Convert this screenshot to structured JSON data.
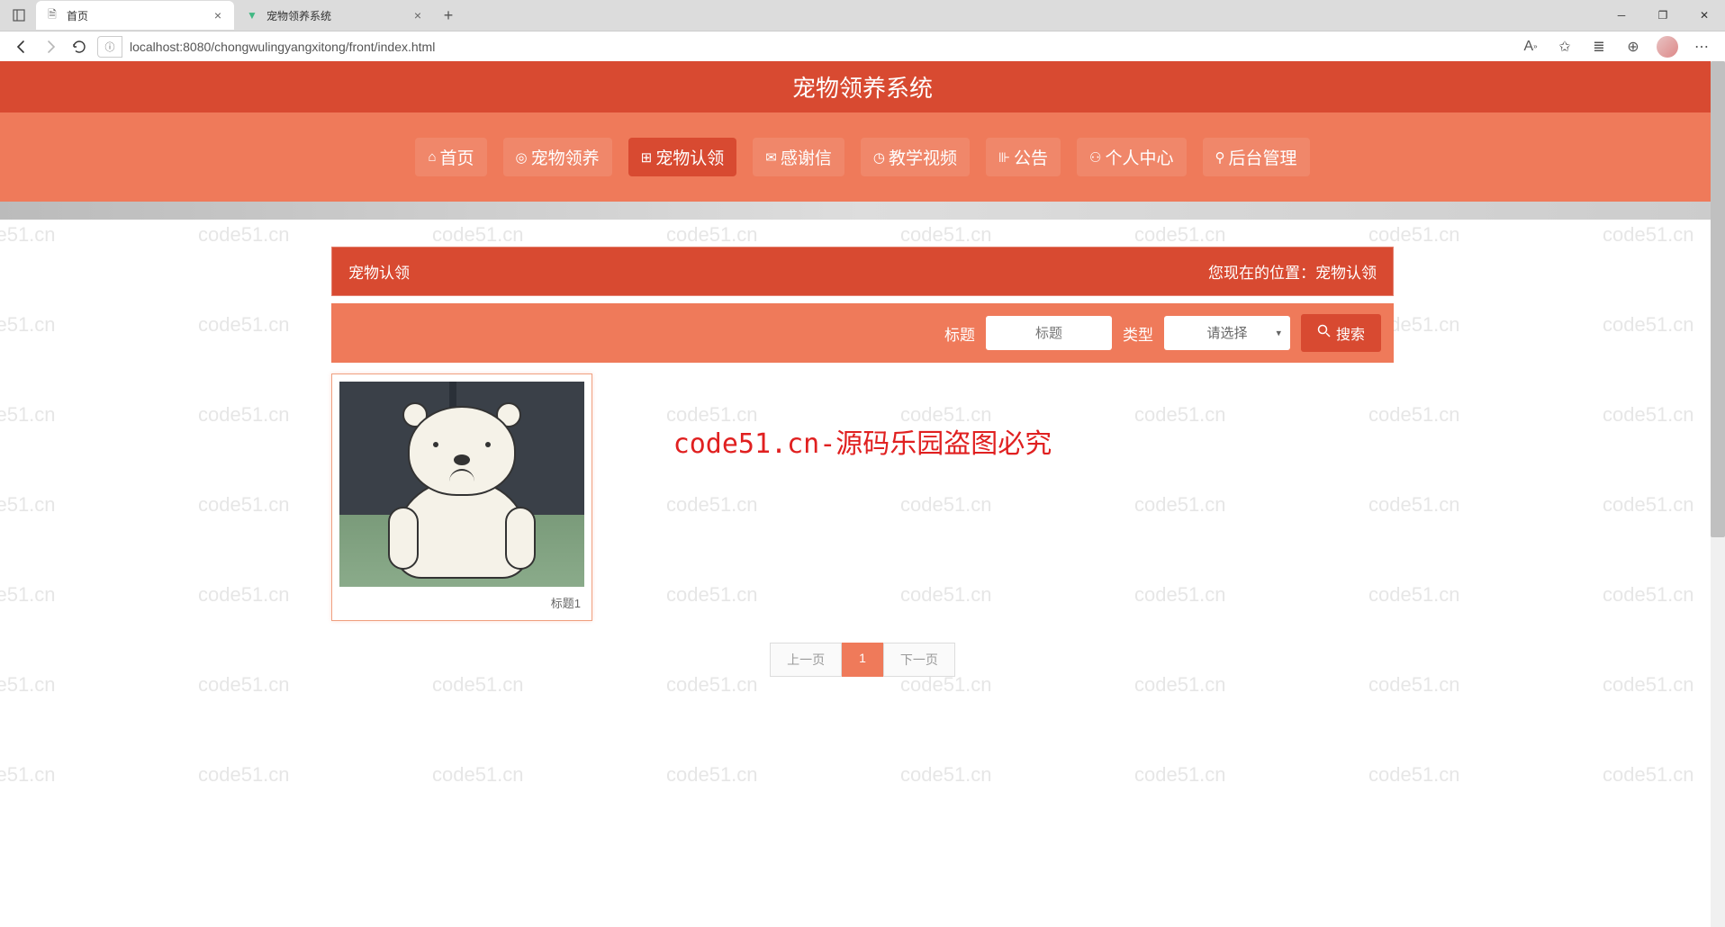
{
  "browser": {
    "tabs": [
      {
        "title": "首页",
        "active": true
      },
      {
        "title": "宠物领养系统",
        "active": false
      }
    ],
    "url": "localhost:8080/chongwulingyangxitong/front/index.html"
  },
  "header": {
    "title": "宠物领养系统"
  },
  "nav": {
    "items": [
      {
        "icon": "⌂",
        "label": "首页",
        "active": false
      },
      {
        "icon": "◎",
        "label": "宠物领养",
        "active": false
      },
      {
        "icon": "⊞",
        "label": "宠物认领",
        "active": true
      },
      {
        "icon": "✉",
        "label": "感谢信",
        "active": false
      },
      {
        "icon": "◷",
        "label": "教学视频",
        "active": false
      },
      {
        "icon": "⊪",
        "label": "公告",
        "active": false
      },
      {
        "icon": "⚇",
        "label": "个人中心",
        "active": false
      },
      {
        "icon": "⚲",
        "label": "后台管理",
        "active": false
      }
    ]
  },
  "breadcrumb": {
    "title": "宠物认领",
    "location_label": "您现在的位置：",
    "location_value": "宠物认领"
  },
  "search": {
    "title_label": "标题",
    "title_placeholder": "标题",
    "type_label": "类型",
    "type_placeholder": "请选择",
    "button_label": "搜索"
  },
  "cards": [
    {
      "caption": "标题1"
    }
  ],
  "watermark_notice": "code51.cn-源码乐园盗图必究",
  "watermark_text": "code51.cn",
  "pagination": {
    "prev": "上一页",
    "current": "1",
    "next": "下一页"
  }
}
